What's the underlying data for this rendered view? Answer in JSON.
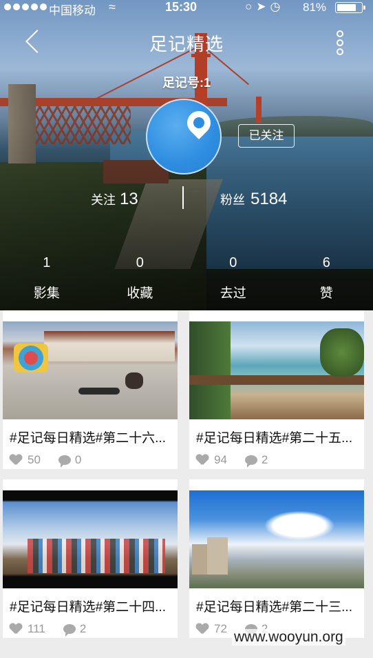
{
  "status_bar": {
    "carrier": "中国移动",
    "time": "15:30",
    "battery": "81%",
    "battery_level": 0.81
  },
  "nav": {
    "title": "足记精选"
  },
  "profile": {
    "footnote_id": "足记号:1",
    "follow_status": "已关注",
    "following_label": "关注",
    "following_count": "13",
    "fans_label": "粉丝",
    "fans_count": "5184"
  },
  "counts": [
    {
      "num": "1",
      "label": "影集"
    },
    {
      "num": "0",
      "label": "收藏"
    },
    {
      "num": "0",
      "label": "去过"
    },
    {
      "num": "6",
      "label": "赞"
    }
  ],
  "cards": [
    {
      "title": "#足记每日精选#第二十六...",
      "likes": "50",
      "comments": "0"
    },
    {
      "title": "#足记每日精选#第二十五...",
      "likes": "94",
      "comments": "2"
    },
    {
      "title": "#足记每日精选#第二十四...",
      "likes": "111",
      "comments": "2"
    },
    {
      "title": "#足记每日精选#第二十三...",
      "likes": "72",
      "comments": "2"
    }
  ],
  "watermark": "www.wooyun.org",
  "colors": {
    "avatar_blue": "#2e8de0",
    "bridge_red": "#c0432a",
    "meta_gray": "#999999"
  }
}
